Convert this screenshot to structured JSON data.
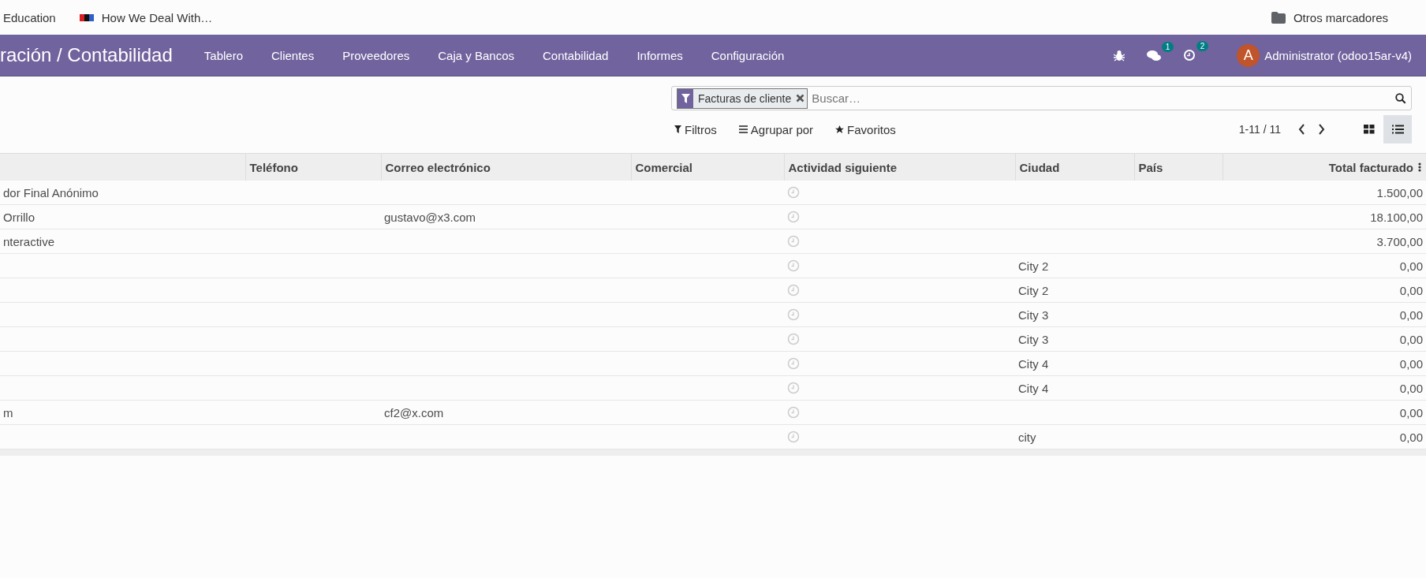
{
  "bookmarks": {
    "items": [
      {
        "label": "Education",
        "kind": "plain"
      },
      {
        "label": "How We Deal With…",
        "kind": "npr"
      }
    ],
    "other": "Otros marcadores"
  },
  "navbar": {
    "title": "ración / Contabilidad",
    "menu": [
      "Tablero",
      "Clientes",
      "Proveedores",
      "Caja y Bancos",
      "Contabilidad",
      "Informes",
      "Configuración"
    ],
    "chat_badge": "1",
    "activity_badge": "2",
    "avatar": "A",
    "user": "Administrator (odoo15ar-v4)"
  },
  "search": {
    "facet": "Facturas de cliente",
    "placeholder": "Buscar…"
  },
  "filters": [
    "Filtros",
    "Agrupar por",
    "Favoritos"
  ],
  "pager": "1-11 / 11",
  "views": [
    {
      "kind": "kanban",
      "selected": false
    },
    {
      "kind": "list",
      "selected": true
    }
  ],
  "table": {
    "columns": [
      "Teléfono",
      "Correo electrónico",
      "Comercial",
      "Actividad siguiente",
      "Ciudad",
      "País",
      "Total facturado"
    ],
    "rows": [
      {
        "name": "dor Final Anónimo",
        "total": "1.500,00"
      },
      {
        "name": "Orrillo",
        "email": "gustavo@x3.com",
        "total": "18.100,00"
      },
      {
        "name": "nteractive",
        "total": "3.700,00"
      },
      {
        "city": "City 2",
        "total": "0,00"
      },
      {
        "city": "City 2",
        "total": "0,00"
      },
      {
        "city": "City 3",
        "total": "0,00"
      },
      {
        "city": "City 3",
        "total": "0,00"
      },
      {
        "city": "City 4",
        "total": "0,00"
      },
      {
        "city": "City 4",
        "total": "0,00"
      },
      {
        "name": "m",
        "email": "cf2@x.com",
        "total": "0,00"
      },
      {
        "city": "city",
        "total": "0,00"
      }
    ]
  }
}
